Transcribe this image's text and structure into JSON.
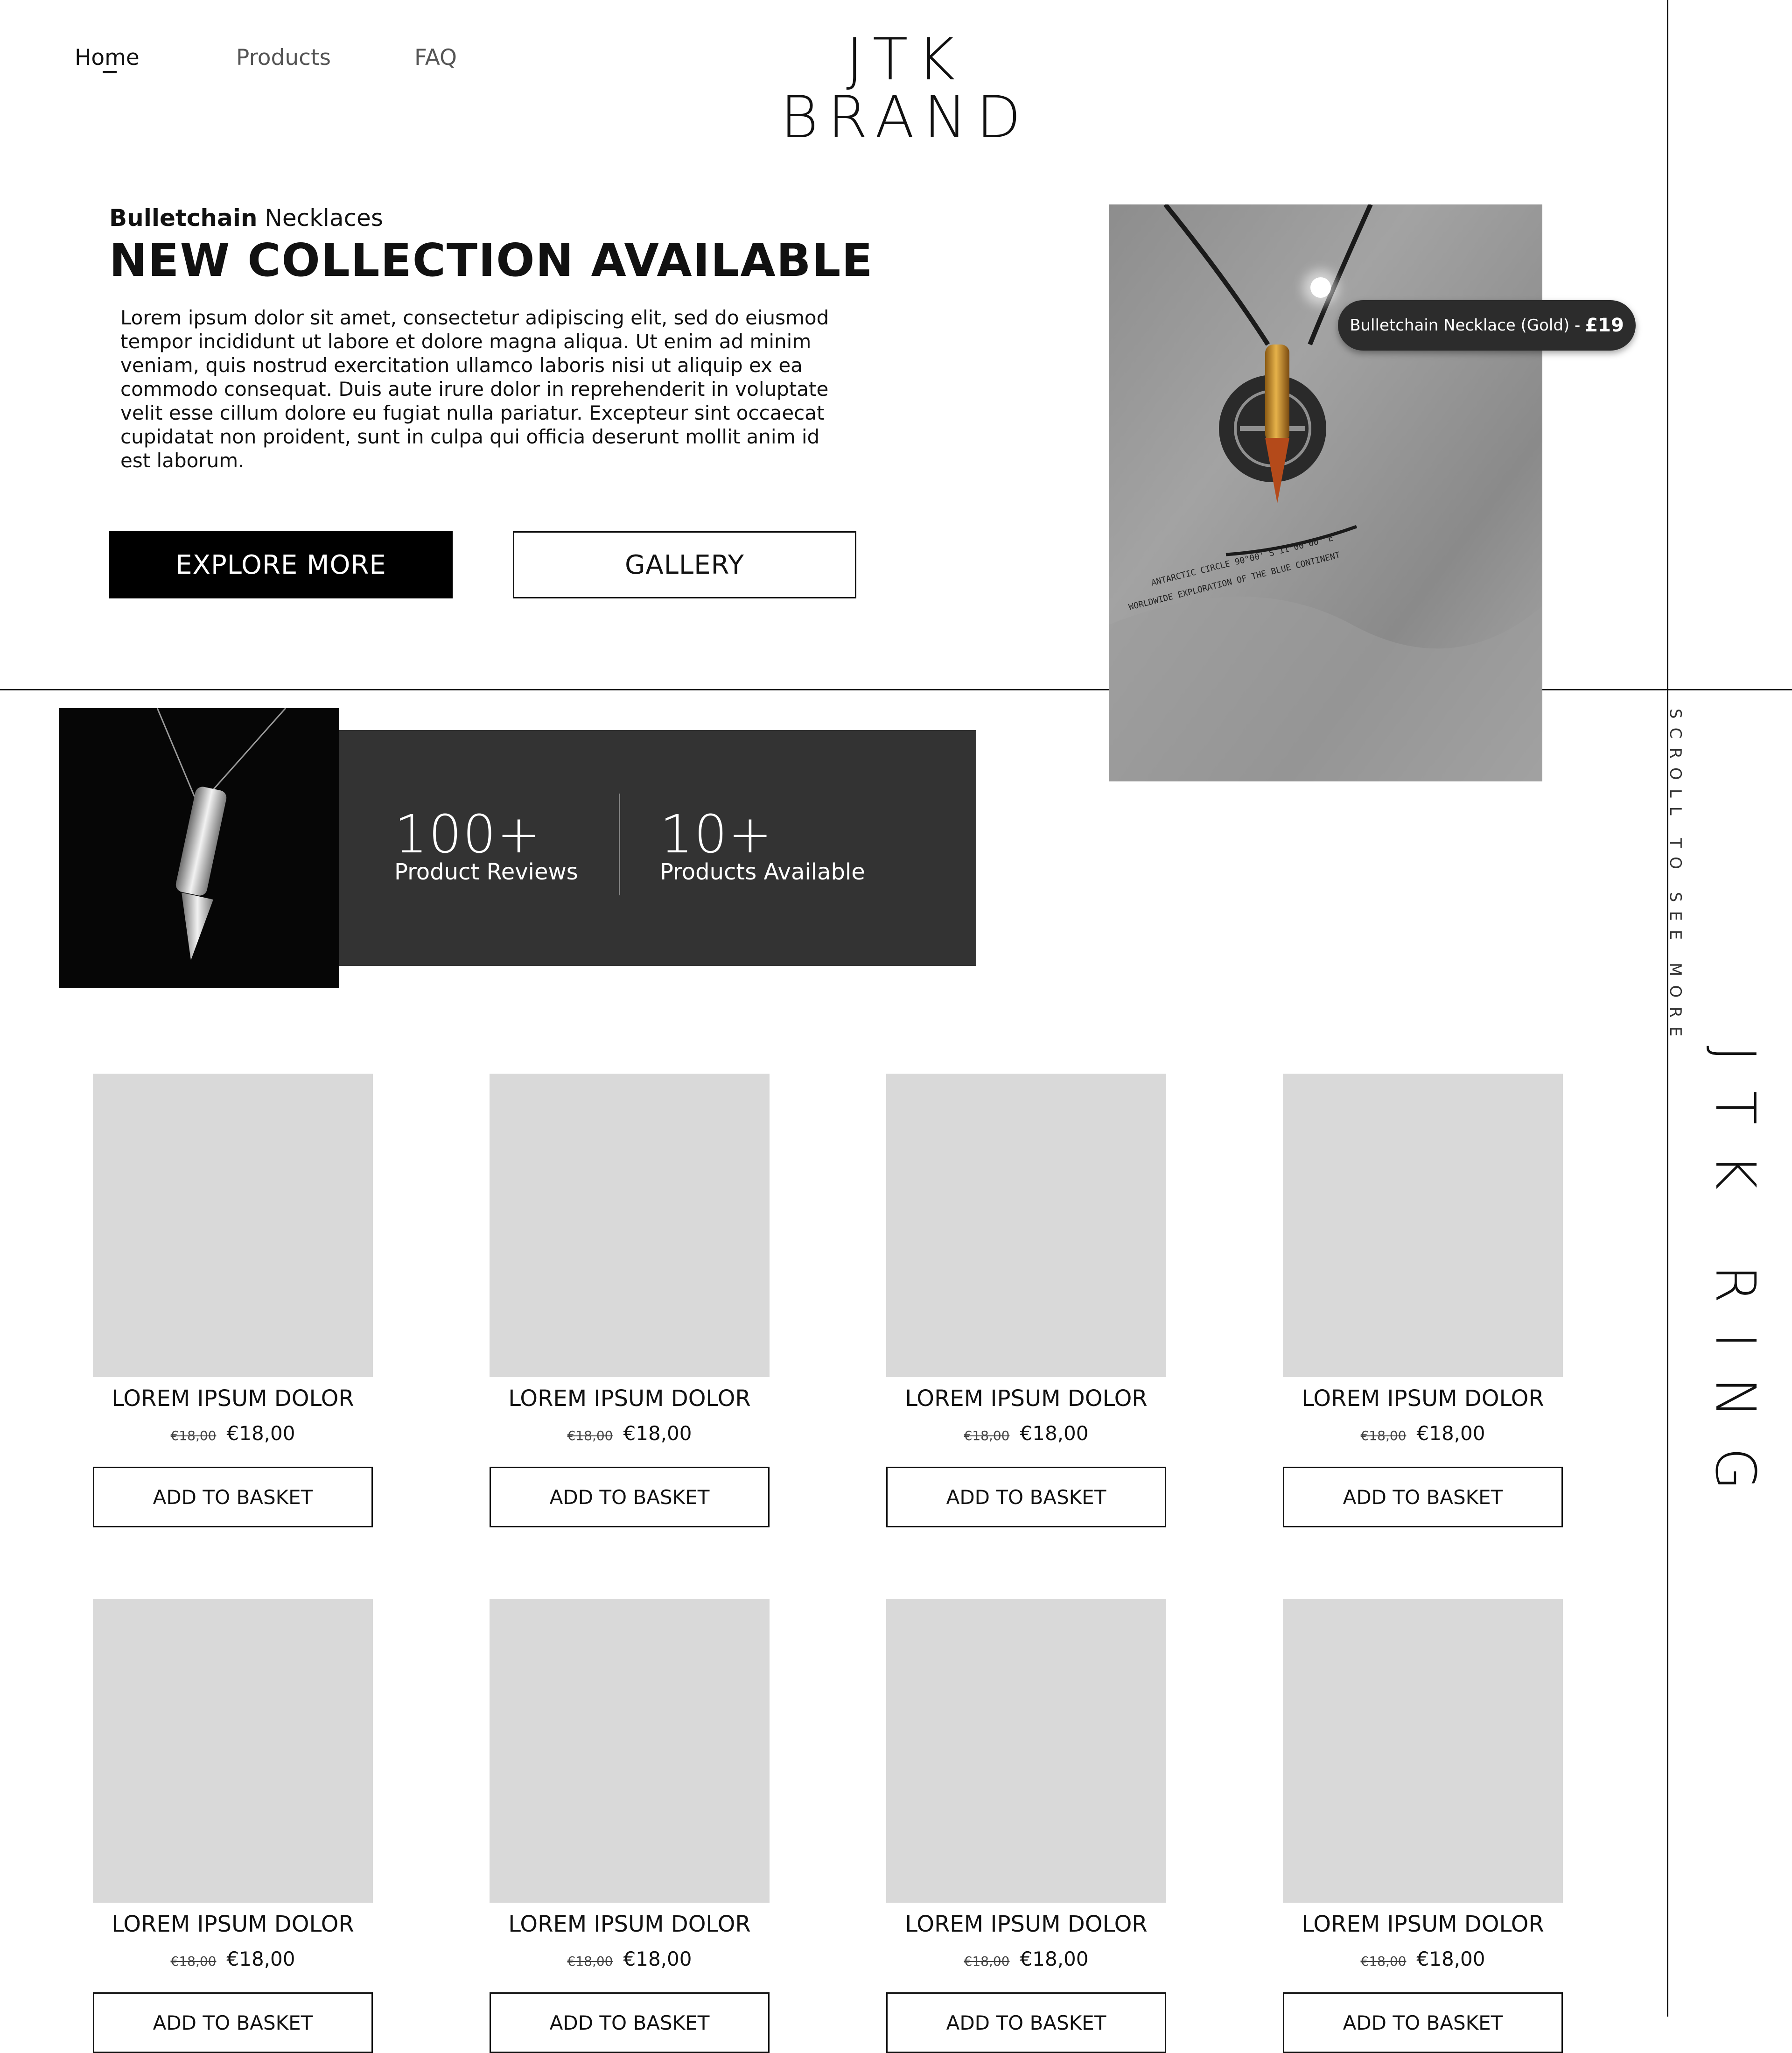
{
  "nav": {
    "items": [
      "Home",
      "Products",
      "FAQ"
    ],
    "active": "Home"
  },
  "brand": {
    "logo_text": "JTK BRAND"
  },
  "hero": {
    "eyebrow_bold": "Bulletchain",
    "eyebrow_rest": "Necklaces",
    "title": "NEW COLLECTION AVAILABLE",
    "body": "Lorem ipsum dolor sit amet, consectetur adipiscing elit, sed do eiusmod tempor incididunt ut labore et dolore magna aliqua. Ut enim ad minim veniam, quis nostrud exercitation ullamco laboris nisi ut aliquip ex ea commodo consequat. Duis aute irure dolor in reprehenderit in voluptate velit esse cillum dolore eu fugiat nulla pariatur. Excepteur sint occaecat cupidatat non proident, sunt in culpa qui officia deserunt mollit anim id est laborum.",
    "explore_label": "EXPLORE MORE",
    "gallery_label": "GALLERY",
    "hotspot_label": "Bulletchain Necklace (Gold) -",
    "hotspot_price": "£19",
    "shirt_print_line1": "ANTARCTIC CIRCLE 90°00' S 11°00°00\" E",
    "shirt_print_line2": "WORLDWIDE EXPLORATION OF THE BLUE CONTINENT"
  },
  "stats": [
    {
      "value": "100+",
      "label": "Product Reviews"
    },
    {
      "value": "10+",
      "label": "Products Available"
    }
  ],
  "rail": {
    "scroll_text": "SCROLL TO SEE MORE",
    "big_text": "JTK RING"
  },
  "products": [
    {
      "title": "LOREM IPSUM DOLOR",
      "old_price": "€18,00",
      "price": "€18,00",
      "button": "ADD TO BASKET"
    },
    {
      "title": "LOREM IPSUM DOLOR",
      "old_price": "€18,00",
      "price": "€18,00",
      "button": "ADD TO BASKET"
    },
    {
      "title": "LOREM IPSUM DOLOR",
      "old_price": "€18,00",
      "price": "€18,00",
      "button": "ADD TO BASKET"
    },
    {
      "title": "LOREM IPSUM DOLOR",
      "old_price": "€18,00",
      "price": "€18,00",
      "button": "ADD TO BASKET"
    },
    {
      "title": "LOREM IPSUM DOLOR",
      "old_price": "€18,00",
      "price": "€18,00",
      "button": "ADD TO BASKET"
    },
    {
      "title": "LOREM IPSUM DOLOR",
      "old_price": "€18,00",
      "price": "€18,00",
      "button": "ADD TO BASKET"
    },
    {
      "title": "LOREM IPSUM DOLOR",
      "old_price": "€18,00",
      "price": "€18,00",
      "button": "ADD TO BASKET"
    },
    {
      "title": "LOREM IPSUM DOLOR",
      "old_price": "€18,00",
      "price": "€18,00",
      "button": "ADD TO BASKET"
    }
  ],
  "colors": {
    "accent": "#000000",
    "stats_bg": "#333333",
    "placeholder": "#d9d9d9",
    "tag_bg": "#2c2c2c",
    "gold": "#c8922e"
  }
}
